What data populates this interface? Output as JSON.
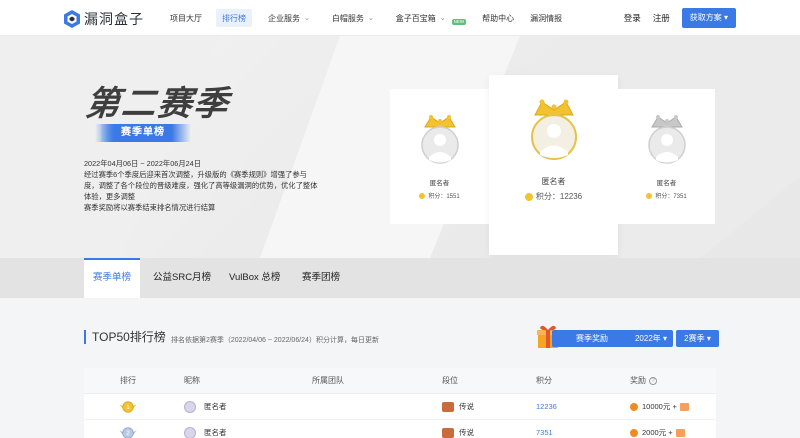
{
  "nav": {
    "logo_text": "漏洞盒子",
    "items": [
      {
        "label": "项目大厅",
        "dropdown": false,
        "active": false
      },
      {
        "label": "排行榜",
        "dropdown": false,
        "active": true
      },
      {
        "label": "企业服务",
        "dropdown": true,
        "active": false
      },
      {
        "label": "白帽服务",
        "dropdown": true,
        "active": false
      },
      {
        "label": "盒子百宝箱",
        "dropdown": true,
        "active": false,
        "badge": "NEW"
      },
      {
        "label": "帮助中心",
        "dropdown": false,
        "active": false
      },
      {
        "label": "漏洞情报",
        "dropdown": false,
        "active": false
      }
    ],
    "login": "登录",
    "register": "注册",
    "cta": "获取方案"
  },
  "hero": {
    "title": "第二赛季",
    "badge": "赛季单榜",
    "desc_lines": [
      "2022年04月06日 ~ 2022年06月24日",
      "经过赛季6个季度后迎来首次调整，升级版的《赛季规则》增强了参与",
      "度，调整了各个段位的晋级难度，强化了高等级漏洞的优势，优化了整体",
      "体验，更多调整",
      "赛季奖励将以赛季结束排名情况进行结算"
    ]
  },
  "podium": {
    "second": {
      "name": "匿名者",
      "score_label": "积分：1551"
    },
    "first": {
      "name": "匿名者",
      "score_label": "积分：12236"
    },
    "third": {
      "name": "匿名者",
      "score_label": "积分：7351"
    }
  },
  "tabs": [
    "赛季单榜",
    "公益SRC月榜",
    "VulBox 总榜",
    "赛季团榜"
  ],
  "ranking": {
    "title": "TOP50排行榜",
    "note": "排名依据第2赛季（2022/04/06 ~ 2022/06/24）积分计算，每日更新",
    "reward_button": "赛季奖励",
    "year_select": "2022年",
    "season_select": "2赛季",
    "columns": [
      "排行",
      "昵称",
      "所属团队",
      "段位",
      "积分",
      "奖励"
    ],
    "rows": [
      {
        "nickname": "匿名者",
        "team": "",
        "level": "传说",
        "score": "12236",
        "reward": "10000元 +"
      },
      {
        "nickname": "匿名者",
        "team": "",
        "level": "传说",
        "score": "7351",
        "reward": "2000元 +"
      }
    ]
  },
  "colors": {
    "accent": "#3b7ae6",
    "gold": "#f2c230",
    "silver": "#bdbdbd",
    "orange": "#f08b20"
  }
}
